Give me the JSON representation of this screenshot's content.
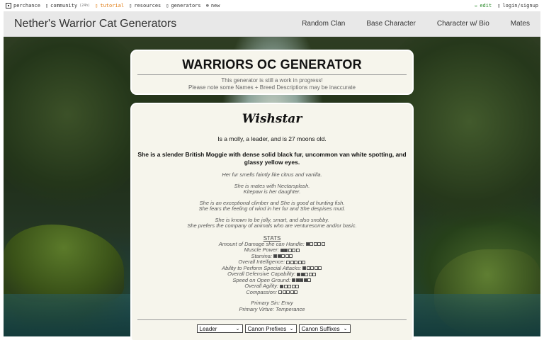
{
  "topbar": {
    "items": [
      {
        "label": "perchance",
        "icon": "dice-icon"
      },
      {
        "label": "community",
        "badge": "(24h)",
        "icon": "chat-icon"
      },
      {
        "label": "tutorial",
        "icon": "book-icon"
      },
      {
        "label": "resources",
        "icon": "folder-icon"
      },
      {
        "label": "generators",
        "icon": "list-icon"
      },
      {
        "label": "new",
        "icon": "plus-circle-icon"
      }
    ],
    "edit": "edit",
    "login": "login/signup"
  },
  "header": {
    "title": "Nether's Warrior Cat Generators",
    "nav": [
      "Random Clan",
      "Base Character",
      "Character w/ Bio",
      "Mates"
    ]
  },
  "title_card": {
    "heading": "WARRIORS OC GENERATOR",
    "note_line1": "This generator is still a work in progress!",
    "note_line2": "Please note some Names + Breed Descriptions may be inaccurate"
  },
  "character": {
    "name": "Wishstar",
    "age_line": "Is a molly, a leader, and is 27 moons old.",
    "description": "She is a slender British Moggie with dense solid black fur, uncommon van white spotting, and glassy yellow eyes.",
    "scent": "Her fur smells faintly like citrus and vanilla.",
    "mates": "She is mates with Nectarsplash.",
    "kin": "Kitepaw is her daughter.",
    "skill": "She is an exceptional climber and She is good at hunting fish.",
    "fears": "She fears the feeling of wind in her fur and She despises mud.",
    "traits": "She is known to be jolly, smart, and also snobby.",
    "company": "She prefers the company of animals who are venturesome and/or basic.",
    "stats_heading": "STATS",
    "stats": [
      {
        "label": "Amount of Damage she can Handle:",
        "level": 1
      },
      {
        "label": "Muscle Power:",
        "level": 2
      },
      {
        "label": "Stamina:",
        "level": 2
      },
      {
        "label": "Overall Intelligence:",
        "level": 0
      },
      {
        "label": "Ability to Perform Special Attacks:",
        "level": 1
      },
      {
        "label": "Overall Defensive Capability:",
        "level": 2
      },
      {
        "label": "Speed on Open Ground:",
        "level": 4
      },
      {
        "label": "Overall Agility:",
        "level": 1
      },
      {
        "label": "Compassion:",
        "level": 0
      }
    ],
    "sin": "Primary Sin: Envy",
    "virtue": "Primary Virtue: Temperance"
  },
  "controls": {
    "rank": "Leader",
    "prefixes": "Canon Prefixes",
    "suffixes": "Canon Suffixes"
  }
}
